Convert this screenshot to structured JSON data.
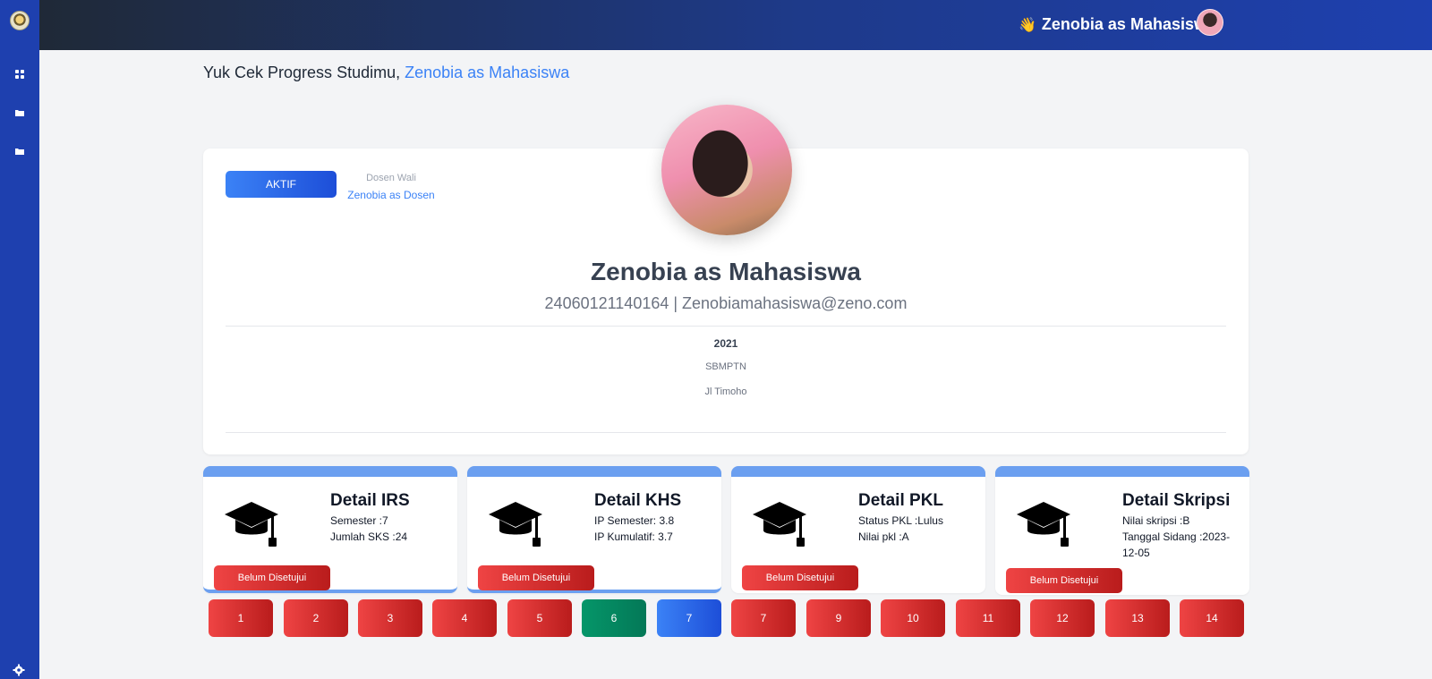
{
  "topbar": {
    "wave": "👋",
    "user_name": "Zenobia as Mahasiswa"
  },
  "sidebar": {
    "icons": [
      "dashboard-icon",
      "folder-icon",
      "folder-icon",
      "gear-icon"
    ]
  },
  "greeting": {
    "prefix": "Yuk Cek Progress Studimu, ",
    "name": "Zenobia as Mahasiswa"
  },
  "profile": {
    "status": "AKTIF",
    "dosen_label": "Dosen Wali",
    "dosen_name": "Zenobia as Dosen",
    "name": "Zenobia as Mahasiswa",
    "meta": "24060121140164 | Zenobiamahasiswa@zeno.com",
    "angkatan": "2021",
    "jalur": "SBMPTN",
    "alamat": "Jl Timoho"
  },
  "cards": [
    {
      "title": "Detail IRS",
      "lines": [
        "Semester :7",
        "Jumlah SKS :24"
      ],
      "button": "Belum Disetujui"
    },
    {
      "title": "Detail KHS",
      "lines": [
        "IP Semester: 3.8",
        "IP Kumulatif: 3.7"
      ],
      "button": "Belum Disetujui"
    },
    {
      "title": "Detail PKL",
      "lines": [
        "Status PKL :Lulus",
        "Nilai pkl :A"
      ],
      "button": "Belum Disetujui"
    },
    {
      "title": "Detail Skripsi",
      "lines": [
        "Nilai skripsi :B",
        "Tanggal Sidang :2023-12-05"
      ],
      "button": "Belum Disetujui"
    }
  ],
  "semesters": [
    "1",
    "2",
    "3",
    "4",
    "5",
    "6",
    "7",
    "7",
    "9",
    "10",
    "11",
    "12",
    "13",
    "14"
  ],
  "colors": {
    "red": "#dc2626",
    "green": "#059669",
    "blue": "#2563eb",
    "accent": "#3b82f6"
  }
}
